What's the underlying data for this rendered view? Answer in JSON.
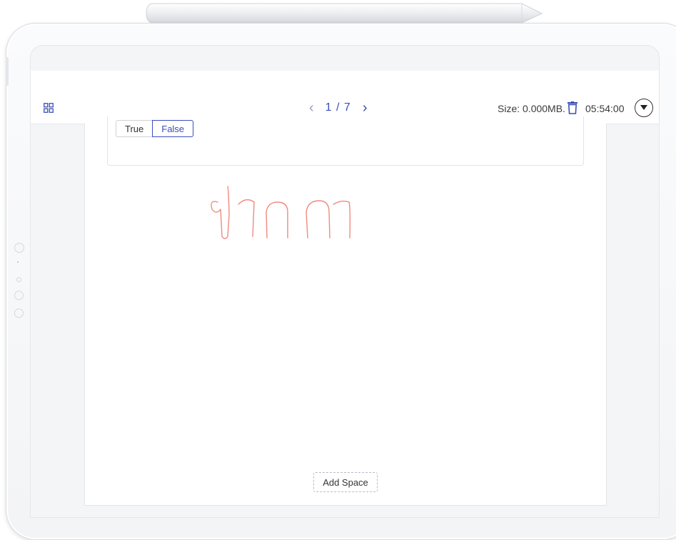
{
  "header": {
    "page_indicator": "1 / 7",
    "prev_icon": "chevron-left-icon",
    "next_icon": "chevron-right-icon",
    "size_label": "Size: 0.000MB.",
    "timer": "05:54:00",
    "grid_icon": "grid-icon",
    "trash_icon": "trash-icon",
    "menu_icon": "caret-down-icon"
  },
  "tools": {
    "move": "move-icon",
    "pen": "pen-icon",
    "highlighter": "highlighter-icon",
    "eraser": "eraser-icon",
    "color": "#ee9c9c",
    "active_tool": "pen"
  },
  "question": {
    "option_true": "True",
    "option_false": "False",
    "selected": "False"
  },
  "canvas": {
    "handwriting_color": "#ef8a80"
  },
  "footer": {
    "add_space_label": "Add Space"
  },
  "colors": {
    "accent": "#3a4eb8",
    "active_border": "#c8267a"
  }
}
